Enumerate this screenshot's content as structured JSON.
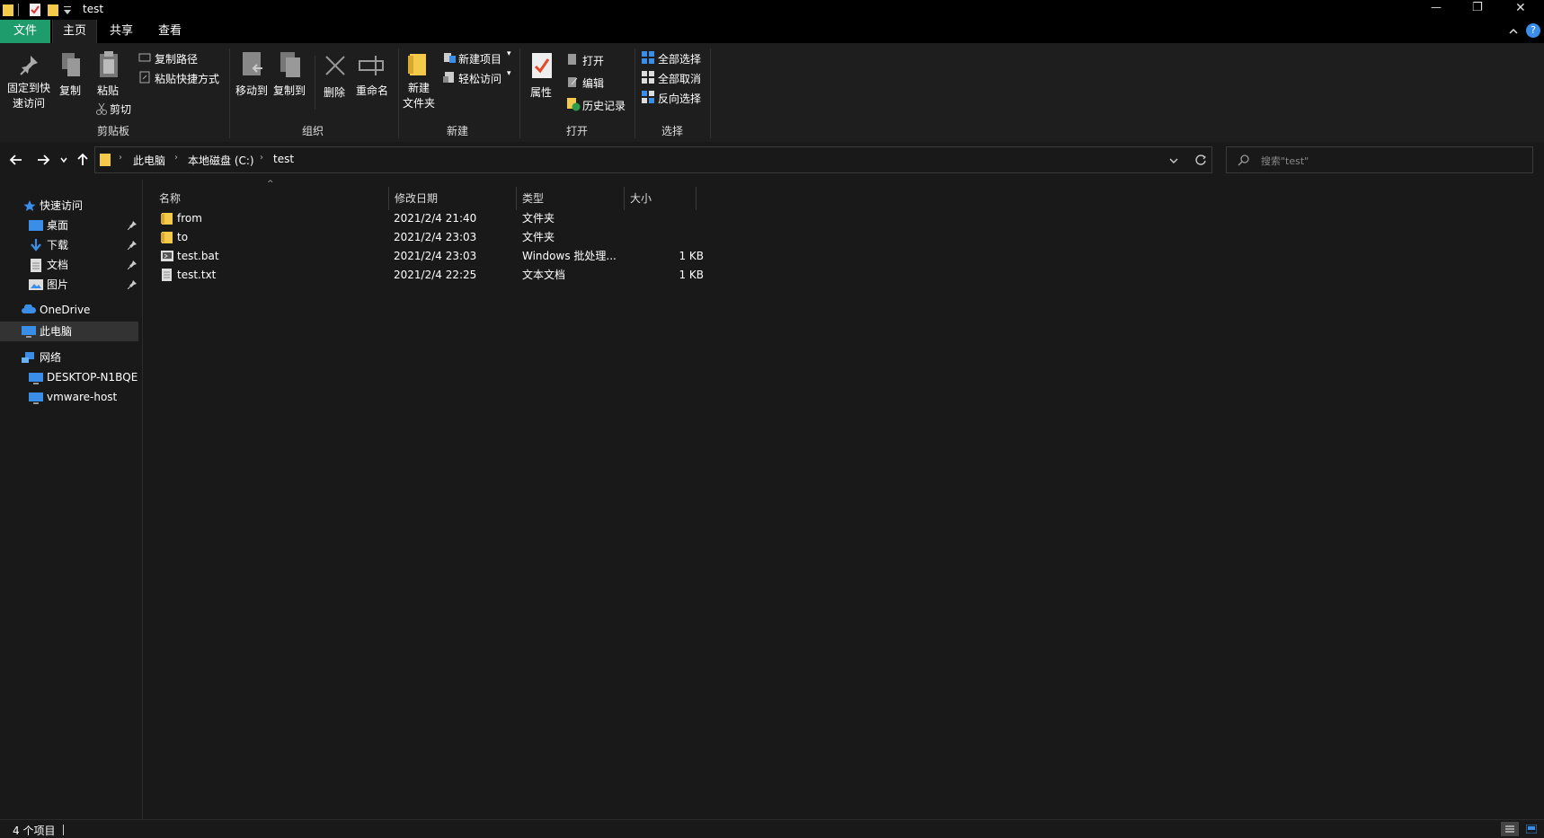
{
  "window": {
    "title": "test",
    "minimize_symbol": "—",
    "maximize_symbol": "❐",
    "close_symbol": "✕",
    "help_symbol": "?"
  },
  "ribbon_tabs": [
    "文件",
    "主页",
    "共享",
    "查看"
  ],
  "ribbon": {
    "clipboard": {
      "pin_line1": "固定到快",
      "pin_line2": "速访问",
      "copy": "复制",
      "paste": "粘贴",
      "copy_path": "复制路径",
      "paste_shortcut": "粘贴快捷方式",
      "cut": "剪切",
      "group": "剪贴板"
    },
    "organize": {
      "move_to": "移动到",
      "copy_to": "复制到",
      "delete": "删除",
      "rename": "重命名",
      "group": "组织"
    },
    "new": {
      "new_folder_line1": "新建",
      "new_folder_line2": "文件夹",
      "new_item": "新建项目",
      "easy_access": "轻松访问",
      "group": "新建"
    },
    "open": {
      "properties": "属性",
      "open": "打开",
      "edit": "编辑",
      "history": "历史记录",
      "group": "打开"
    },
    "select": {
      "select_all": "全部选择",
      "select_none": "全部取消",
      "invert": "反向选择",
      "group": "选择"
    }
  },
  "address": {
    "crumbs": [
      "此电脑",
      "本地磁盘 (C:)",
      "test"
    ],
    "search_placeholder": "搜索\"test\""
  },
  "nav": {
    "quick_access": "快速访问",
    "desktop": "桌面",
    "downloads": "下载",
    "documents": "文档",
    "pictures": "图片",
    "onedrive": "OneDrive",
    "this_pc": "此电脑",
    "network": "网络",
    "host1": "DESKTOP-N1BQE",
    "host2": "vmware-host"
  },
  "columns": [
    "名称",
    "修改日期",
    "类型",
    "大小"
  ],
  "files": [
    {
      "name": "from",
      "date": "2021/2/4 21:40",
      "type": "文件夹",
      "size": "",
      "icon": "folder-icon"
    },
    {
      "name": "to",
      "date": "2021/2/4 23:03",
      "type": "文件夹",
      "size": "",
      "icon": "folder-icon"
    },
    {
      "name": "test.bat",
      "date": "2021/2/4 23:03",
      "type": "Windows 批处理...",
      "size": "1 KB",
      "icon": "batch-file-icon"
    },
    {
      "name": "test.txt",
      "date": "2021/2/4 22:25",
      "type": "文本文档",
      "size": "1 KB",
      "icon": "text-file-icon"
    }
  ],
  "status": {
    "item_count": "4 个项目"
  },
  "colors": {
    "file_tab": "#1f9c6c",
    "folder": "#f5c94a",
    "accent_blue": "#3b8ee8",
    "selected_nav": "#333333"
  }
}
